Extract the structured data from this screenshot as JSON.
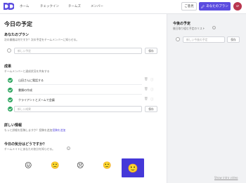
{
  "nav": {
    "items": [
      {
        "label": "ホーム"
      },
      {
        "label": "チェックイン"
      },
      {
        "label": "チームズ"
      },
      {
        "label": "メンバー"
      }
    ],
    "feedback_label": "ご意見",
    "plan_label": "あなたのプラン",
    "avatar_text": "SP",
    "brand_color": "#5b4ce0"
  },
  "main": {
    "title": "今日の予定",
    "plan": {
      "heading": "あなたのプラン",
      "subtitle": "次の業務は何ですか？次の予定をチームメンバーに知らせる。",
      "input_placeholder": "新しい予定",
      "save_label": "保存"
    },
    "results": {
      "heading": "成果",
      "subtitle": "チームメンバーと達成状況を共有する",
      "tasks": [
        {
          "label": "山田さんに電話する"
        },
        {
          "label": "書類の作成"
        },
        {
          "label": "クライアントとズームで会議"
        }
      ],
      "input_placeholder": "新しい成果",
      "save_label": "保存"
    },
    "details": {
      "heading": "詳しい情報",
      "text_prefix": "もっと詳細を投稿しますか？投稿を追加",
      "link_label": "投稿を追加"
    },
    "mood": {
      "heading": "今日の気分はどうですか？",
      "subtitle": "チームメイトにあなたの気分を知らせる。",
      "options": [
        "😖",
        "🙁",
        "😣",
        "🙂",
        "🙂"
      ],
      "selected_index": 4
    }
  },
  "side": {
    "heading": "今後の予定",
    "subtitle": "後日取り組む予定のリスト",
    "input_placeholder": "新しい今後の予定",
    "save_label": "保存"
  },
  "footer": {
    "intro_link": "Show intro video"
  }
}
